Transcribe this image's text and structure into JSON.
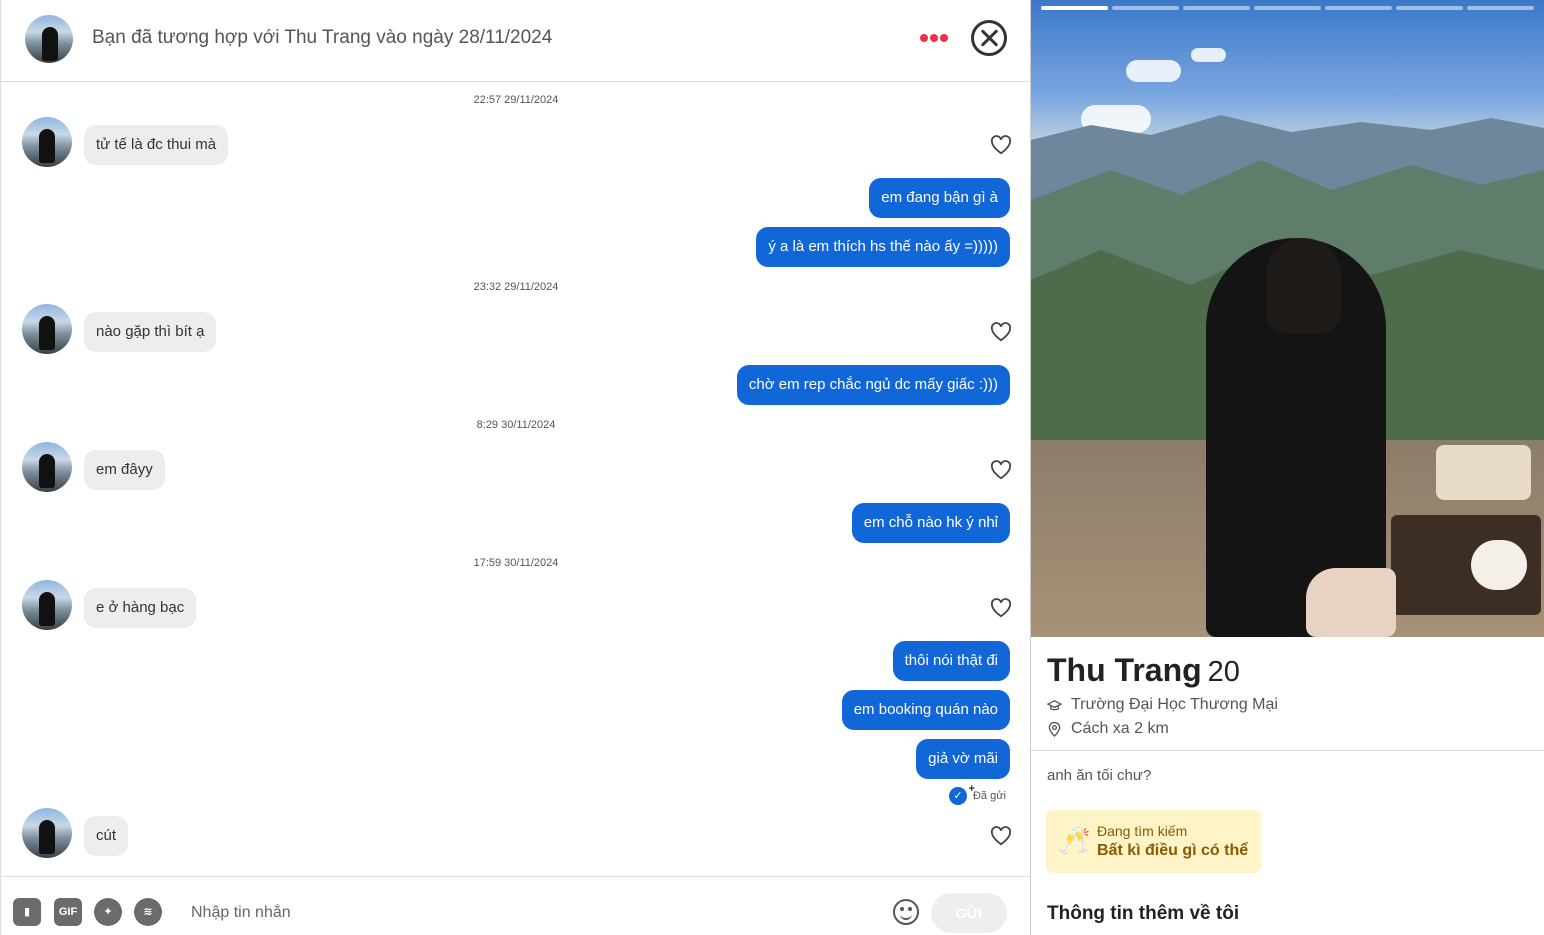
{
  "header": {
    "match_text": "Bạn đã tương hợp với Thu Trang vào ngày 28/11/2024",
    "more_icon": "more-dots-icon",
    "close_icon": "close-circle-icon"
  },
  "messages": [
    {
      "kind": "timestamp",
      "text": "22:57 29/11/2024"
    },
    {
      "kind": "in",
      "text": "tử tế là đc thui mà"
    },
    {
      "kind": "out",
      "text": "em đang bận gì à"
    },
    {
      "kind": "out",
      "text": "ý a là em thích hs thế nào ấy =)))))"
    },
    {
      "kind": "timestamp",
      "text": "23:32 29/11/2024"
    },
    {
      "kind": "in",
      "text": "nào gặp thì bít ạ"
    },
    {
      "kind": "out",
      "text": "chờ em rep chắc ngủ dc mấy giấc :)))"
    },
    {
      "kind": "timestamp",
      "text": "8:29 30/11/2024"
    },
    {
      "kind": "in",
      "text": "em đâyy"
    },
    {
      "kind": "out",
      "text": "em chỗ nào hk ý nhỉ"
    },
    {
      "kind": "timestamp",
      "text": "17:59 30/11/2024"
    },
    {
      "kind": "in",
      "text": "e ở hàng bạc"
    },
    {
      "kind": "out",
      "text": "thôi nói thật đi"
    },
    {
      "kind": "out",
      "text": "em booking quán nào"
    },
    {
      "kind": "out",
      "text": "giả vờ mãi"
    },
    {
      "kind": "in",
      "text": "cút"
    }
  ],
  "sent_status": "Đã gửi",
  "composer": {
    "placeholder": "Nhập tin nhắn",
    "gif_label": "GIF",
    "send_label": "GỬI",
    "tools": [
      "contact-card-icon",
      "gif-icon",
      "sticker-icon",
      "spotify-icon"
    ],
    "emoji_icon": "smiley-icon"
  },
  "profile": {
    "name": "Thu Trang",
    "age": "20",
    "school": "Trường Đại Học Thương Mại",
    "distance": "Cách xa 2 km",
    "bio": "anh ăn tối chư?",
    "looking_label": "Đang tìm kiếm",
    "looking_value": "Bất kì điều gì có thể",
    "looking_emoji": "🥂",
    "more_title": "Thông tin thêm về tôi",
    "photo_count": 7,
    "photo_index": 1
  },
  "colors": {
    "accent_blue": "#1166d8",
    "incoming_bubble": "#ededed",
    "dots_red": "#f0304a",
    "looking_bg": "#fff4c8"
  }
}
